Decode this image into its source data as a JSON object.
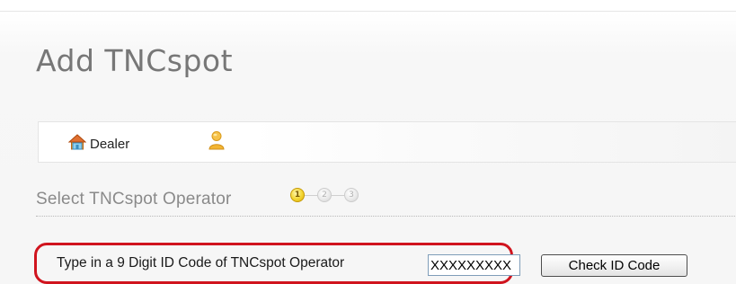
{
  "page": {
    "title": "Add TNCspot"
  },
  "breadcrumb": {
    "items": [
      {
        "label": "Dealer",
        "icon": "home-icon"
      },
      {
        "label": "",
        "icon": "user-icon"
      }
    ]
  },
  "section": {
    "title": "Select TNCspot Operator",
    "steps": [
      {
        "number": "1",
        "state": "active"
      },
      {
        "number": "2",
        "state": "inactive"
      },
      {
        "number": "3",
        "state": "inactive"
      }
    ]
  },
  "id_form": {
    "label": "Type in a 9 Digit ID Code of TNCspot Operator",
    "input_value": "XXXXXXXXX",
    "button_label": "Check ID Code"
  },
  "colors": {
    "highlight_border": "#d0141e",
    "title_gray": "#777777",
    "step_active": "#f3d530"
  }
}
